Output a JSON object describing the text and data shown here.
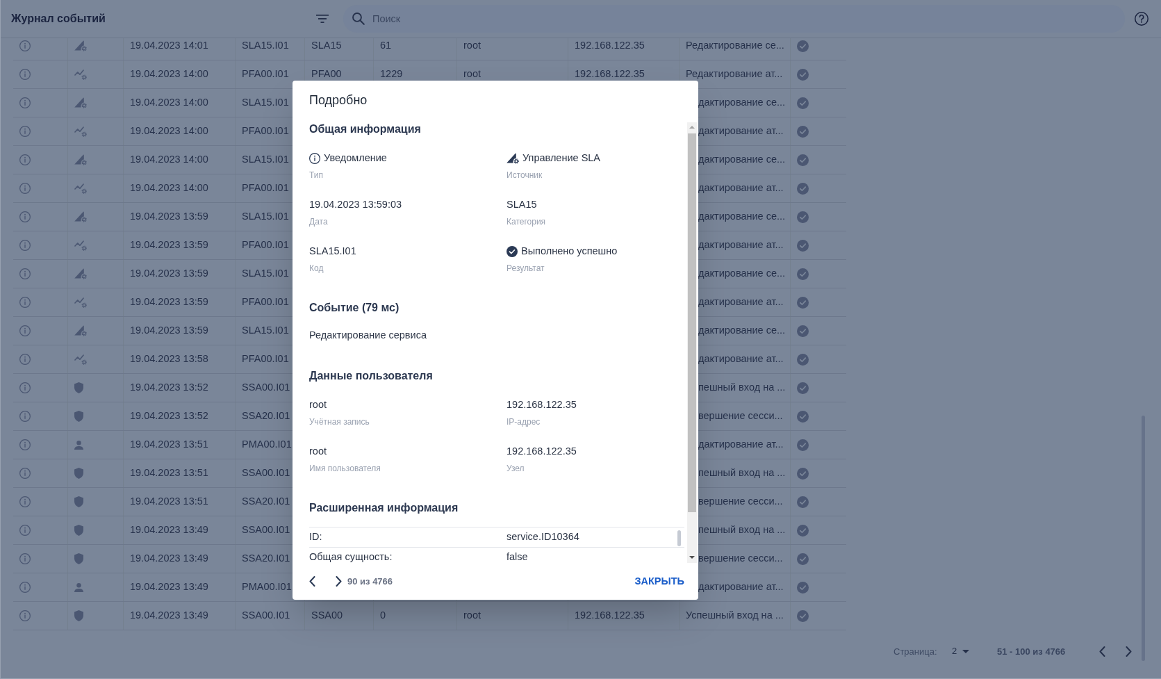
{
  "header": {
    "title": "Журнал событий",
    "search": {
      "placeholder": "Поиск"
    }
  },
  "table": {
    "rows": [
      {
        "kind": "sla",
        "date": "19.04.2023 14:01",
        "code": "SLA15.I01",
        "category": "SLA15",
        "count": "61",
        "user": "root",
        "ip": "192.168.122.35",
        "description": "Редактирование се..."
      },
      {
        "kind": "pfa",
        "date": "19.04.2023 14:00",
        "code": "PFA00.I01",
        "category": "PFA00",
        "count": "1229",
        "user": "root",
        "ip": "192.168.122.35",
        "description": "Редактирование ат..."
      },
      {
        "kind": "sla",
        "date": "19.04.2023 14:00",
        "code": "SLA15.I01",
        "description": "дактирование се..."
      },
      {
        "kind": "pfa",
        "date": "19.04.2023 14:00",
        "code": "PFA00.I01",
        "description": "дактирование ат..."
      },
      {
        "kind": "sla",
        "date": "19.04.2023 14:00",
        "code": "SLA15.I01",
        "description": "дактирование се..."
      },
      {
        "kind": "pfa",
        "date": "19.04.2023 14:00",
        "code": "PFA00.I01",
        "description": "дактирование ат..."
      },
      {
        "kind": "sla",
        "date": "19.04.2023 13:59",
        "code": "SLA15.I01",
        "description": "дактирование се..."
      },
      {
        "kind": "pfa",
        "date": "19.04.2023 13:59",
        "code": "PFA00.I01",
        "description": "дактирование ат..."
      },
      {
        "kind": "sla",
        "date": "19.04.2023 13:59",
        "code": "SLA15.I01",
        "description": "дактирование се..."
      },
      {
        "kind": "pfa",
        "date": "19.04.2023 13:59",
        "code": "PFA00.I01",
        "description": "дактирование ат..."
      },
      {
        "kind": "sla",
        "date": "19.04.2023 13:59",
        "code": "SLA15.I01",
        "description": "дактирование се..."
      },
      {
        "kind": "pfa",
        "date": "19.04.2023 13:58",
        "code": "PFA00.I01",
        "description": "дактирование ат..."
      },
      {
        "kind": "ssa",
        "date": "19.04.2023 13:52",
        "code": "SSA00.I01",
        "description": "пешный вход на ..."
      },
      {
        "kind": "ssa",
        "date": "19.04.2023 13:52",
        "code": "SSA20.I01",
        "description": "вершение сесси..."
      },
      {
        "kind": "pma",
        "date": "19.04.2023 13:51",
        "code": "PMA00.I01",
        "description": "дактирование ат..."
      },
      {
        "kind": "ssa",
        "date": "19.04.2023 13:51",
        "code": "SSA00.I01",
        "description": "пешный вход на ..."
      },
      {
        "kind": "ssa",
        "date": "19.04.2023 13:51",
        "code": "SSA20.I01",
        "description": "вершение сесси..."
      },
      {
        "kind": "ssa",
        "date": "19.04.2023 13:49",
        "code": "SSA00.I01",
        "description": "пешный вход на ..."
      },
      {
        "kind": "ssa",
        "date": "19.04.2023 13:49",
        "code": "SSA20.I01",
        "description": "вершение сесси..."
      },
      {
        "kind": "pma",
        "date": "19.04.2023 13:49",
        "code": "PMA00.I01",
        "description": "дактирование ат..."
      },
      {
        "kind": "ssa",
        "date": "19.04.2023 13:49",
        "code": "SSA00.I01",
        "category": "SSA00",
        "count": "0",
        "user": "root",
        "ip": "192.168.122.35",
        "description": "Успешный вход на ..."
      }
    ]
  },
  "pagination": {
    "label": "Страница:",
    "page": "2",
    "range": "51 - 100 из 4766"
  },
  "dialog": {
    "title": "Подробно",
    "sections": [
      {
        "kind": "fields",
        "title": "Общая информация",
        "fields": [
          {
            "kind": "notice",
            "value": "Уведомление",
            "label": "Тип"
          },
          {
            "kind": "sla",
            "value": "Управление SLA",
            "label": "Источник"
          },
          {
            "kind": "text",
            "value": "19.04.2023 13:59:03",
            "label": "Дата"
          },
          {
            "kind": "text",
            "value": "SLA15",
            "label": "Категория"
          },
          {
            "kind": "text",
            "value": "SLA15.I01",
            "label": "Код"
          },
          {
            "kind": "success",
            "value": "Выполнено успешно",
            "label": "Результат"
          }
        ]
      },
      {
        "kind": "text",
        "title": "Событие (79 мс)",
        "text": "Редактирование сервиса"
      },
      {
        "kind": "fields",
        "title": "Данные пользователя",
        "fields": [
          {
            "kind": "text",
            "value": "root",
            "label": "Учётная запись"
          },
          {
            "kind": "text",
            "value": "192.168.122.35",
            "label": "IP-адрес"
          },
          {
            "kind": "text",
            "value": "root",
            "label": "Имя пользователя"
          },
          {
            "kind": "text",
            "value": "192.168.122.35",
            "label": "Узел"
          }
        ]
      },
      {
        "kind": "table",
        "title": "Расширенная информация",
        "rows": [
          {
            "key": "ID:",
            "value": "service.ID10364"
          },
          {
            "key": "Общая сущность:",
            "value": "false"
          }
        ]
      }
    ],
    "counter": "90 из 4766",
    "close": "ЗАКРЫТЬ"
  }
}
